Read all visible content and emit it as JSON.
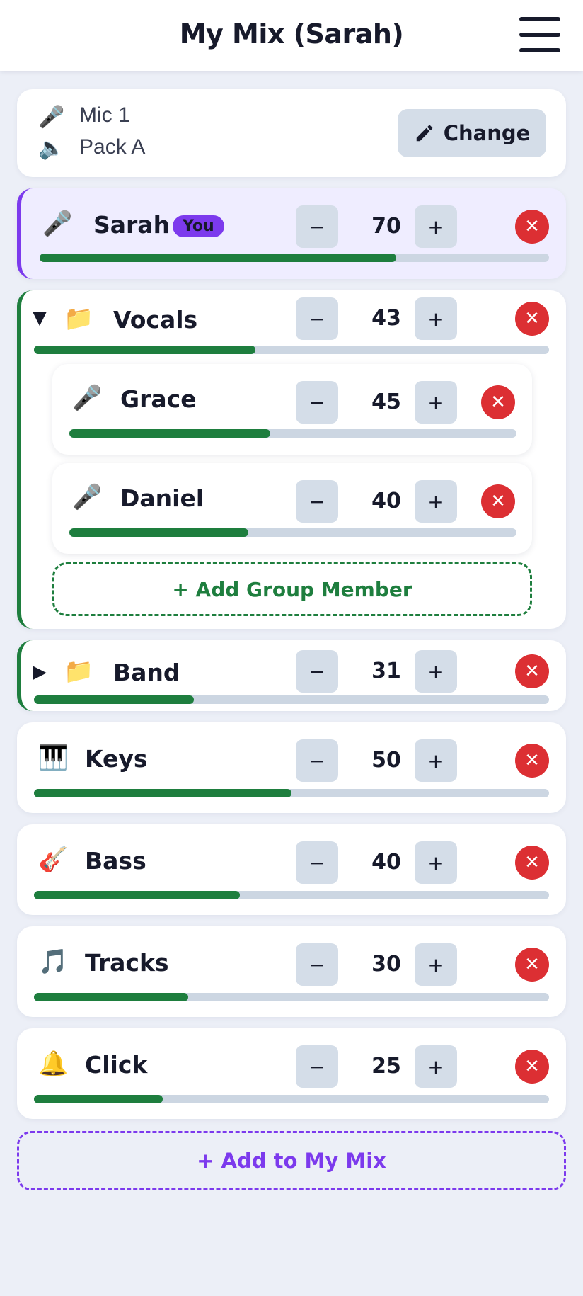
{
  "header": {
    "title": "My Mix (Sarah)"
  },
  "source": {
    "mic": "Mic 1",
    "pack": "Pack A",
    "change_label": "Change"
  },
  "stepper": {
    "minus": "−",
    "plus": "+"
  },
  "colors": {
    "accent_green": "#1e7e3e",
    "accent_purple": "#7c3aed",
    "remove_red": "#dc2f33",
    "track_bg": "#ccd6e2"
  },
  "self": {
    "name": "Sarah",
    "badge": "You",
    "icon": "microphone-icon",
    "volume": 70
  },
  "groups": {
    "vocals": {
      "name": "Vocals",
      "volume": 43,
      "expanded": true,
      "caret": "▼",
      "icon": "folder-icon",
      "members": [
        {
          "name": "Grace",
          "volume": 45,
          "icon": "microphone-icon"
        },
        {
          "name": "Daniel",
          "volume": 40,
          "icon": "microphone-icon"
        }
      ],
      "add_label": "+ Add Group Member"
    },
    "band": {
      "name": "Band",
      "volume": 31,
      "expanded": false,
      "caret": "▶",
      "icon": "folder-icon"
    }
  },
  "channels": [
    {
      "name": "Keys",
      "volume": 50,
      "icon": "piano-icon"
    },
    {
      "name": "Bass",
      "volume": 40,
      "icon": "guitar-icon"
    },
    {
      "name": "Tracks",
      "volume": 30,
      "icon": "music-note-icon"
    },
    {
      "name": "Click",
      "volume": 25,
      "icon": "bell-icon"
    }
  ],
  "add_to_mix_label": "+ Add to My Mix"
}
